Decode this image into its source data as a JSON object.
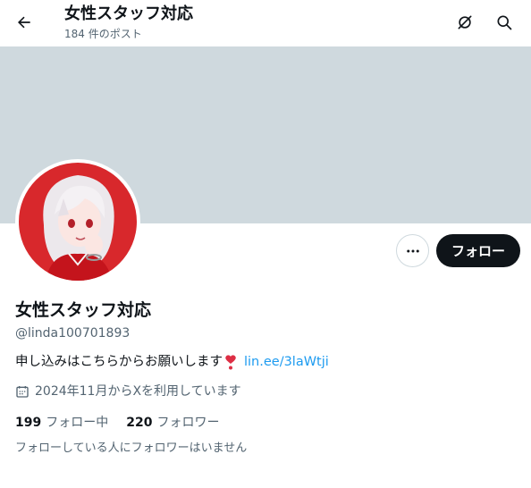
{
  "header": {
    "title": "女性スタッフ対応",
    "post_count": "184 件のポスト"
  },
  "profile": {
    "display_name": "女性スタッフ対応",
    "handle": "@linda100701893",
    "bio_text": "申し込みはこちらからお願いします",
    "bio_link": "lin.ee/3laWtji",
    "joined": "2024年11月からXを利用しています",
    "following_count": "199",
    "following_label": "フォロー中",
    "followers_count": "220",
    "followers_label": "フォロワー",
    "mutual_note": "フォローしている人にフォロワーはいません"
  },
  "actions": {
    "follow_label": "フォロー"
  },
  "icons": [
    "back-arrow-icon",
    "grok-icon",
    "search-icon",
    "more-icon",
    "calendar-icon",
    "heart-exclamation-icon"
  ],
  "colors": {
    "banner": "#cfd9de",
    "follow_button": "#0f1419",
    "link": "#1d9bf0",
    "secondary_text": "#536471",
    "avatar_background": "#d8282c"
  }
}
